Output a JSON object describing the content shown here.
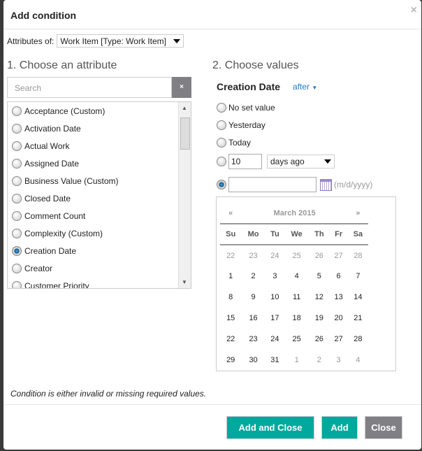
{
  "dialog": {
    "title": "Add condition",
    "close_icon": "×"
  },
  "attributes_of": {
    "label": "Attributes of:",
    "value": "Work Item [Type: Work Item]"
  },
  "left": {
    "heading": "1. Choose an attribute",
    "search_placeholder": "Search",
    "clear_label": "×",
    "items": [
      "Acceptance (Custom)",
      "Activation Date",
      "Actual Work",
      "Assigned Date",
      "Business Value (Custom)",
      "Closed Date",
      "Comment Count",
      "Complexity (Custom)",
      "Creation Date",
      "Creator",
      "Customer Priority"
    ],
    "selected": "Creation Date"
  },
  "right": {
    "heading": "2. Choose values",
    "attribute": "Creation Date",
    "operator": "after",
    "options": {
      "no_set": "No set value",
      "yesterday": "Yesterday",
      "today": "Today",
      "days_value": "10",
      "days_unit": "days ago",
      "date_value": "",
      "date_hint": "(m/d/yyyy)"
    },
    "selected_option": "date",
    "calendar": {
      "prev": "«",
      "next": "»",
      "month": "March 2015",
      "days": [
        "Su",
        "Mo",
        "Tu",
        "We",
        "Th",
        "Fr",
        "Sa"
      ],
      "weeks": [
        [
          "22",
          "23",
          "24",
          "25",
          "26",
          "27",
          "28"
        ],
        [
          "1",
          "2",
          "3",
          "4",
          "5",
          "6",
          "7"
        ],
        [
          "8",
          "9",
          "10",
          "11",
          "12",
          "13",
          "14"
        ],
        [
          "15",
          "16",
          "17",
          "18",
          "19",
          "20",
          "21"
        ],
        [
          "22",
          "23",
          "24",
          "25",
          "26",
          "27",
          "28"
        ],
        [
          "29",
          "30",
          "31",
          "1",
          "2",
          "3",
          "4"
        ]
      ]
    }
  },
  "footer": {
    "message": "Condition is either invalid or missing required values.",
    "add_and_close": "Add and Close",
    "add": "Add",
    "close": "Close"
  },
  "colors": {
    "primary": "#00a89d",
    "secondary": "#808084",
    "link": "#2a7ac0"
  }
}
